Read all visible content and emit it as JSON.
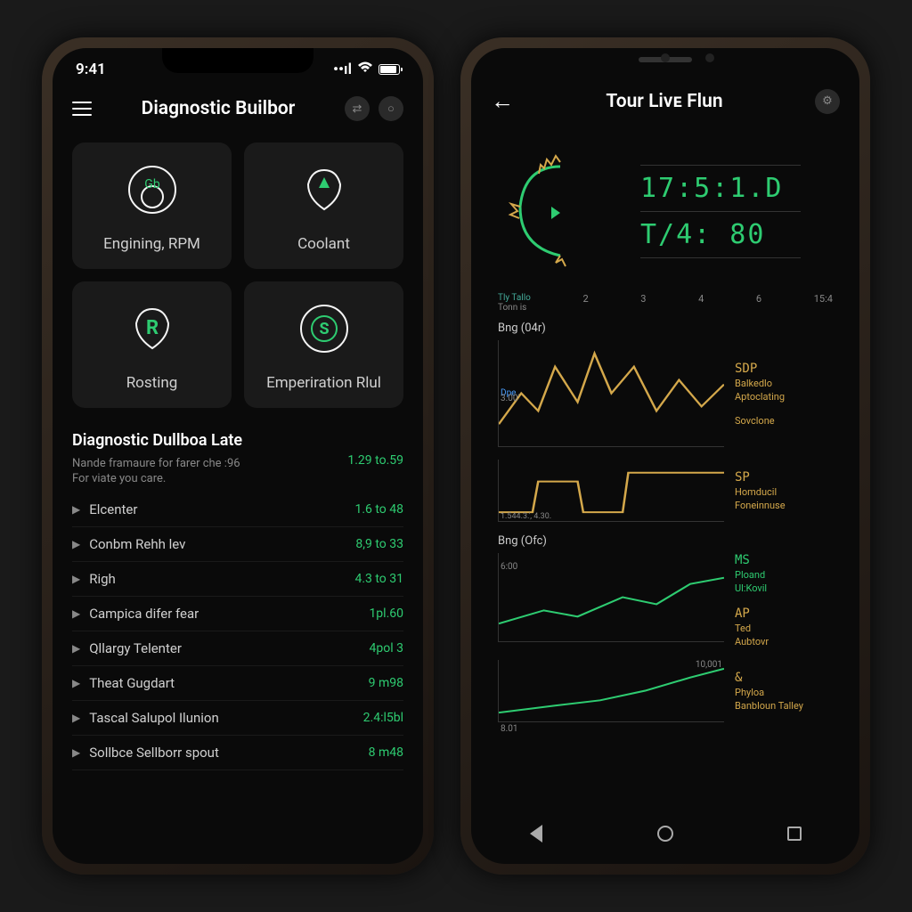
{
  "left": {
    "status_time": "9:41",
    "header_title": "Diagnostic Builbor",
    "header_icon1": "⇄",
    "header_icon2": "○",
    "tiles": [
      {
        "label": "Engining, RPM"
      },
      {
        "label": "Coolant"
      },
      {
        "label": "Rosting"
      },
      {
        "label": "Emperiration Rlul"
      }
    ],
    "section": {
      "title": "Diagnostic Dullboa Late",
      "sub1": "Nande framaure for farer che :96",
      "sub2": "For viate you care.",
      "value": "1.29 to.59"
    },
    "list": [
      {
        "label": "Elcenter",
        "value": "1.6 to 48"
      },
      {
        "label": "Conbm Rehh lev",
        "value": "8,9 to 33"
      },
      {
        "label": "Righ",
        "value": "4.3 to 31"
      },
      {
        "label": "Campica difer fear",
        "value": "1pl.60"
      },
      {
        "label": "Qllargy Telenter",
        "value": "4pol 3"
      },
      {
        "label": "Theat Gugdart",
        "value": "9 m98"
      },
      {
        "label": "Tascal Salupol Ilunion",
        "value": "2.4:l5bl"
      },
      {
        "label": "Sollbce Sellborr spout",
        "value": "8 m48"
      }
    ]
  },
  "right": {
    "header_title": "Tour Livᴇ Flun",
    "reading1": "17:5:1.D",
    "reading2": "T/4: 80",
    "axis": {
      "left_a": "Tly Tallo",
      "left_b": "Tonn is",
      "ticks": [
        "2",
        "3",
        "4",
        "6",
        "15:4"
      ]
    },
    "charts": [
      {
        "title": "Bng (04r)",
        "ytick": "3.00'",
        "ylabel": "Dpe",
        "legend": [
          {
            "a": "SDP",
            "b": "Balkedlo",
            "c": "Aptoclating"
          },
          {
            "a": "",
            "b": "Sovclone",
            "c": ""
          }
        ]
      },
      {
        "title": "",
        "ytick": "1.544.3.', 4.30.",
        "legend": [
          {
            "a": "SP",
            "b": "Homducil",
            "c": "Foneinnuse"
          }
        ]
      },
      {
        "title": "Bng (Ofc)",
        "ytick": "6:00",
        "legend": [
          {
            "a": "MS",
            "b": "Ploand",
            "c": "Ul:Kovil",
            "green": true
          },
          {
            "a": "AP",
            "b": "Ted",
            "c": "Aubtovr"
          }
        ]
      },
      {
        "title": "",
        "ytick": "8.01",
        "ytick2": "10,001",
        "legend": [
          {
            "a": "&",
            "b": "Phyloa",
            "c": "Banbloun Talley"
          }
        ]
      }
    ]
  },
  "chart_data": [
    {
      "type": "line",
      "title": "Bng (04r)",
      "x": [
        0,
        1,
        2,
        3,
        4,
        5,
        6,
        7,
        8,
        9,
        10
      ],
      "series": [
        {
          "name": "Balkedlo",
          "values": [
            20,
            45,
            30,
            70,
            40,
            85,
            50,
            75,
            30,
            60,
            40
          ]
        }
      ],
      "ylabel": "Dpe",
      "ylim": [
        0,
        100
      ]
    },
    {
      "type": "line",
      "title": "",
      "x": [
        0,
        1,
        2,
        3,
        4,
        5,
        6,
        7,
        8
      ],
      "series": [
        {
          "name": "Homducil",
          "values": [
            10,
            10,
            40,
            40,
            10,
            10,
            50,
            50,
            50
          ]
        }
      ],
      "ylim": [
        0,
        60
      ]
    },
    {
      "type": "line",
      "title": "Bng (Ofc)",
      "x": [
        0,
        1,
        2,
        3,
        4,
        5,
        6
      ],
      "series": [
        {
          "name": "Ploand",
          "values": [
            15,
            25,
            20,
            35,
            30,
            40,
            45
          ]
        }
      ],
      "ylim": [
        0,
        60
      ]
    },
    {
      "type": "line",
      "title": "",
      "x": [
        0,
        1,
        2,
        3,
        4,
        5
      ],
      "series": [
        {
          "name": "Phyloa",
          "values": [
            10,
            15,
            18,
            22,
            30,
            38
          ]
        }
      ],
      "ylim": [
        0,
        50
      ]
    }
  ]
}
